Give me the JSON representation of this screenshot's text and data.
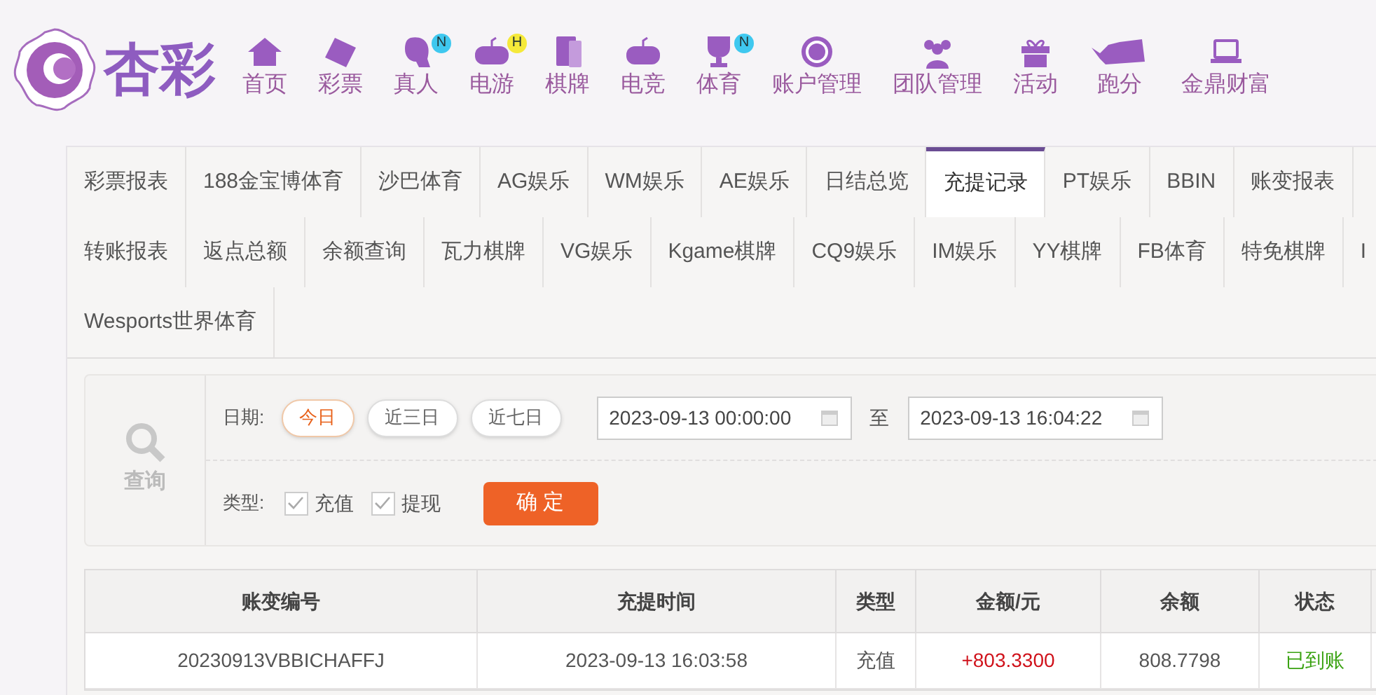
{
  "logo": {
    "text": "杏彩"
  },
  "nav": [
    {
      "label": "首页"
    },
    {
      "label": "彩票"
    },
    {
      "label": "真人",
      "badge": {
        "text": "N",
        "color": "#3fc8ef"
      }
    },
    {
      "label": "电游",
      "badge": {
        "text": "H",
        "color": "#f5e93a"
      }
    },
    {
      "label": "棋牌"
    },
    {
      "label": "电竞"
    },
    {
      "label": "体育",
      "badge": {
        "text": "N",
        "color": "#3fc8ef"
      }
    },
    {
      "label": "账户管理"
    },
    {
      "label": "团队管理"
    },
    {
      "label": "活动"
    },
    {
      "label": "跑分"
    },
    {
      "label": "金鼎财富"
    }
  ],
  "tab_rows": [
    {
      "tabs": [
        {
          "label": "彩票报表",
          "selected": false
        },
        {
          "label": "188金宝博体育",
          "selected": false
        },
        {
          "label": "沙巴体育",
          "selected": false
        },
        {
          "label": "AG娱乐",
          "selected": false
        },
        {
          "label": "WM娱乐",
          "selected": false
        },
        {
          "label": "AE娱乐",
          "selected": false
        },
        {
          "label": "日结总览",
          "selected": false
        },
        {
          "label": "充提记录",
          "selected": true
        },
        {
          "label": "PT娱乐",
          "selected": false
        },
        {
          "label": "BBIN",
          "selected": false
        },
        {
          "label": "账变报表",
          "selected": false
        }
      ]
    },
    {
      "tabs": [
        {
          "label": "转账报表",
          "selected": false
        },
        {
          "label": "返点总额",
          "selected": false
        },
        {
          "label": "余额查询",
          "selected": false
        },
        {
          "label": "瓦力棋牌",
          "selected": false
        },
        {
          "label": "VG娱乐",
          "selected": false
        },
        {
          "label": "Kgame棋牌",
          "selected": false
        },
        {
          "label": "CQ9娱乐",
          "selected": false
        },
        {
          "label": "IM娱乐",
          "selected": false
        },
        {
          "label": "YY棋牌",
          "selected": false
        },
        {
          "label": "FB体育",
          "selected": false
        },
        {
          "label": "特免棋牌",
          "selected": false
        },
        {
          "label": "I",
          "selected": false
        }
      ]
    },
    {
      "tabs": [
        {
          "label": "Wesports世界体育",
          "selected": false
        }
      ]
    }
  ],
  "query": {
    "label": "查询",
    "date_label": "日期:",
    "ranges": [
      {
        "label": "今日",
        "selected": true
      },
      {
        "label": "近三日",
        "selected": false
      },
      {
        "label": "近七日",
        "selected": false
      }
    ],
    "start": "2023-09-13 00:00:00",
    "to": "至",
    "end": "2023-09-13 16:04:22",
    "type_label": "类型:",
    "types": [
      {
        "label": "充值",
        "checked": true
      },
      {
        "label": "提现",
        "checked": true
      }
    ],
    "confirm": "确 定"
  },
  "table": {
    "columns": [
      "账变编号",
      "充提时间",
      "类型",
      "金额/元",
      "余额",
      "状态"
    ],
    "rows": [
      {
        "cells": [
          "20230913VBBICHAFFJ",
          "2023-09-13 16:03:58",
          "充值",
          "+803.3300",
          "808.7798",
          "已到账"
        ]
      }
    ]
  }
}
